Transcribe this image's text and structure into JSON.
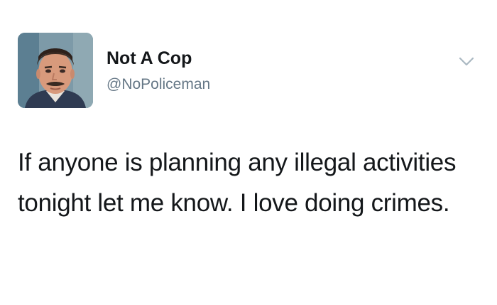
{
  "tweet": {
    "display_name": "Not A Cop",
    "handle": "@NoPoliceman",
    "text": "If anyone is planning any illegal activities tonight let me know. I love doing crimes.",
    "avatar_icon": "profile-photo-icon",
    "menu_icon": "chevron-down-icon"
  },
  "colors": {
    "name": "#14171a",
    "handle": "#657786",
    "background": "#ffffff"
  }
}
